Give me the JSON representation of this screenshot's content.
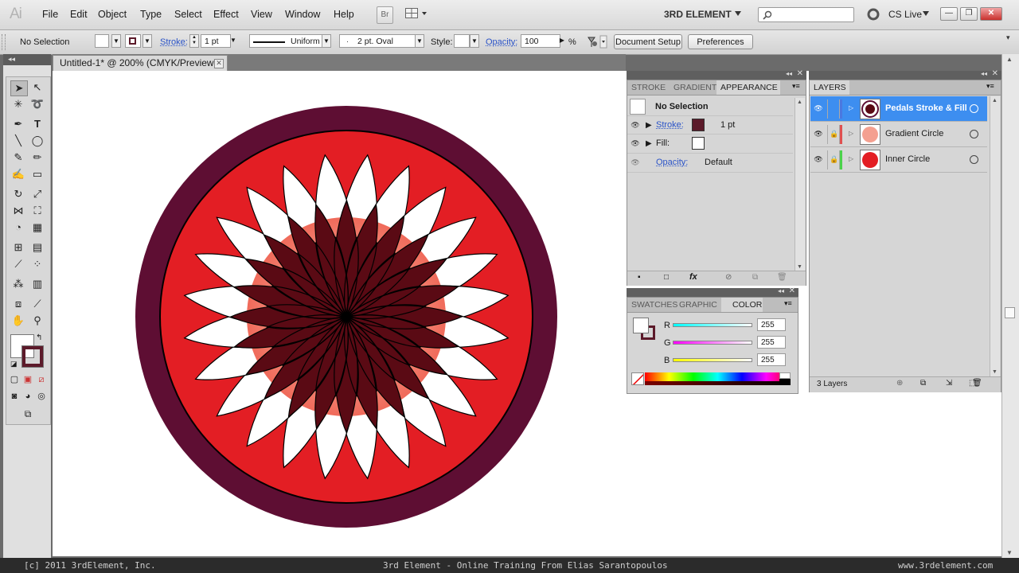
{
  "app": {
    "logo": "Ai"
  },
  "menu": [
    "File",
    "Edit",
    "Object",
    "Type",
    "Select",
    "Effect",
    "View",
    "Window",
    "Help"
  ],
  "menubar": {
    "bridge_label": "Br",
    "workspace": "3RD ELEMENT",
    "cs_live": "CS Live"
  },
  "control": {
    "selection": "No Selection",
    "stroke_label": "Stroke:",
    "stroke_weight": "1 pt",
    "profile": "Uniform",
    "brush": "2 pt. Oval",
    "style_label": "Style:",
    "opacity_label": "Opacity:",
    "opacity_value": "100",
    "percent": "%",
    "doc_setup": "Document Setup",
    "preferences": "Preferences"
  },
  "document": {
    "tab_title": "Untitled-1* @ 200% (CMYK/Preview)"
  },
  "appearance": {
    "tabs": [
      "STROKE",
      "GRADIENT",
      "APPEARANCE"
    ],
    "selection": "No Selection",
    "stroke_label": "Stroke:",
    "stroke_value": "1 pt",
    "fill_label": "Fill:",
    "opacity_label": "Opacity:",
    "opacity_value": "Default",
    "stroke_color": "#5c1a2a"
  },
  "color": {
    "tabs": [
      "SWATCHES",
      "GRAPHIC S",
      "COLOR"
    ],
    "r_label": "R",
    "g_label": "G",
    "b_label": "B",
    "r": "255",
    "g": "255",
    "b": "255"
  },
  "layers": {
    "tab": "LAYERS",
    "items": [
      {
        "name": "Pedals Stroke & Fill",
        "color": "#4a78e0"
      },
      {
        "name": "Gradient Circle",
        "color": "#e05050"
      },
      {
        "name": "Inner Circle",
        "color": "#4ad24a"
      }
    ],
    "count": "3 Layers"
  },
  "artwork": {
    "outer_ring": "#5e0e33",
    "inner_circle": "#e31e24",
    "petal_dark": "#5a0a14",
    "petal_light": "#ffffff"
  },
  "footer": {
    "left": "[c] 2011 3rdElement, Inc.",
    "center": "3rd Element - Online Training From Elias Sarantopoulos",
    "right": "www.3rdelement.com"
  }
}
